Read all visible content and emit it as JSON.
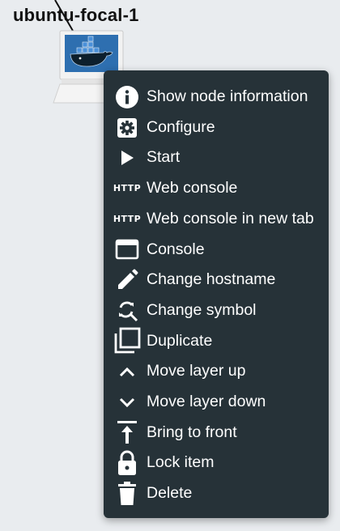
{
  "node": {
    "label": "ubuntu-focal-1",
    "icon": "docker-host-icon"
  },
  "menu": {
    "items": [
      {
        "label": "Show node information",
        "icon": "info-icon"
      },
      {
        "label": "Configure",
        "icon": "gear-icon"
      },
      {
        "label": "Start",
        "icon": "play-icon"
      },
      {
        "label": "Web console",
        "icon": "http-icon",
        "icon_text": "HTTP"
      },
      {
        "label": "Web console in new tab",
        "icon": "http-icon",
        "icon_text": "HTTP"
      },
      {
        "label": "Console",
        "icon": "console-window-icon"
      },
      {
        "label": "Change hostname",
        "icon": "pencil-icon"
      },
      {
        "label": "Change symbol",
        "icon": "symbol-search-icon"
      },
      {
        "label": "Duplicate",
        "icon": "duplicate-icon"
      },
      {
        "label": "Move layer up",
        "icon": "chevron-up-icon"
      },
      {
        "label": "Move layer down",
        "icon": "chevron-down-icon"
      },
      {
        "label": "Bring to front",
        "icon": "bring-to-front-icon"
      },
      {
        "label": "Lock item",
        "icon": "lock-icon"
      },
      {
        "label": "Delete",
        "icon": "trash-icon"
      }
    ]
  },
  "colors": {
    "canvas_background": "#e9ecef",
    "menu_background": "#263238",
    "menu_text": "#ffffff"
  }
}
